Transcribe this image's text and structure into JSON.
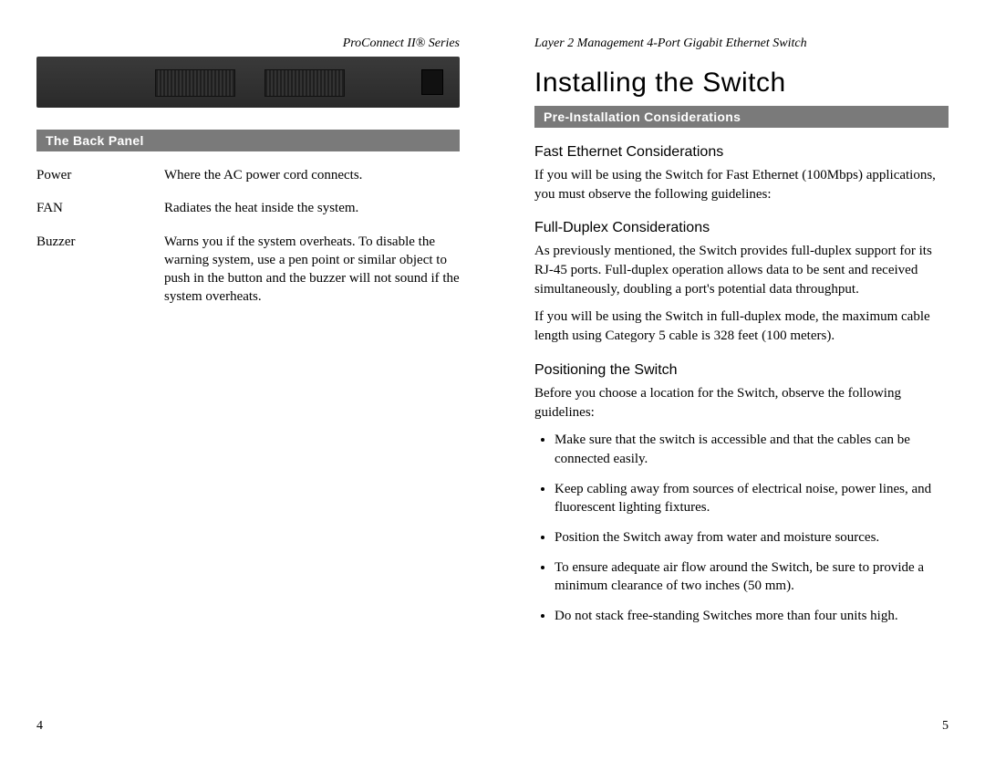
{
  "left": {
    "running_head": "ProConnect II® Series",
    "section_bar": "The Back Panel",
    "defs": [
      {
        "term": "Power",
        "desc": "Where the AC power cord connects."
      },
      {
        "term": "FAN",
        "desc": "Radiates the heat inside the system."
      },
      {
        "term": "Buzzer",
        "desc": "Warns you if the system overheats. To disable the warning system, use a pen point or similar object to push in the button and the buzzer will not sound if the system overheats."
      }
    ],
    "page_number": "4"
  },
  "right": {
    "running_head": "Layer 2 Management 4-Port Gigabit Ethernet Switch",
    "h1": "Installing the Switch",
    "section_bar": "Pre-Installation Considerations",
    "sub1": "Fast Ethernet Considerations",
    "p1": "If you will be using the Switch for Fast Ethernet (100Mbps) applications, you must observe the following guidelines:",
    "sub2": "Full-Duplex Considerations",
    "p2": "As previously mentioned, the Switch provides full-duplex support for its RJ-45 ports. Full-duplex operation allows data to be sent and received simultaneously, doubling a port's potential data throughput.",
    "p3": "If you will be using the Switch in full-duplex mode, the maximum cable length using Category 5 cable is 328 feet (100 meters).",
    "sub3": "Positioning the Switch",
    "p4": "Before you choose a location for the Switch, observe the following guidelines:",
    "bullets": [
      "Make sure that the switch is accessible and that the cables can be connected easily.",
      "Keep cabling away from sources of electrical noise, power lines, and fluorescent lighting fixtures.",
      "Position the Switch away from water and moisture sources.",
      "To ensure adequate air flow around the Switch, be sure to provide a minimum clearance of two inches (50 mm).",
      "Do not stack free-standing Switches more than four units high."
    ],
    "page_number": "5"
  }
}
